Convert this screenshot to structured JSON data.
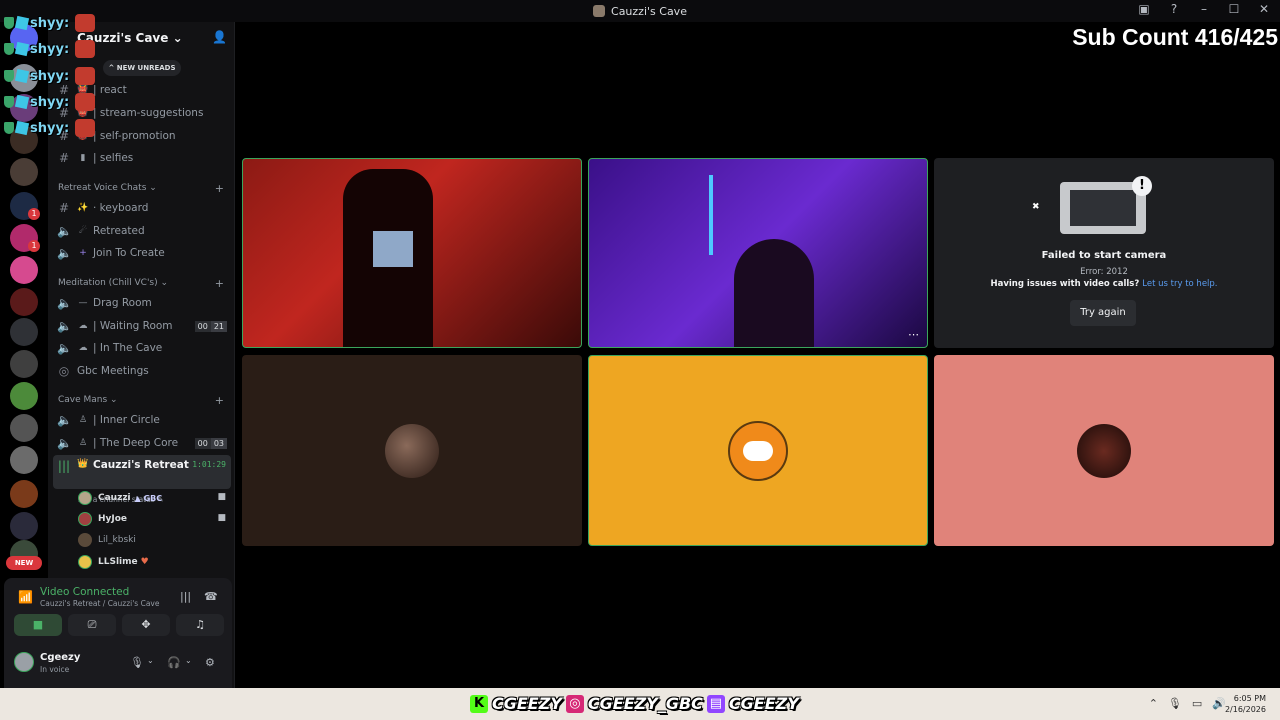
{
  "window": {
    "title": "Cauzzi's Cave",
    "controls": [
      "inbox-icon",
      "help-icon",
      "minimize",
      "maximize",
      "close"
    ]
  },
  "overlay": {
    "username": "shyy:",
    "rows": 5
  },
  "server": {
    "name": "Cauzzi's Cave ⌄",
    "new_unreads": "^ NEW UNREADS",
    "rail_new_badge": "NEW",
    "rail_badges": [
      "1",
      "1",
      "1"
    ]
  },
  "channels": {
    "top": [
      {
        "emoji": "",
        "label": "| react"
      },
      {
        "emoji": "",
        "label": "| stream-suggestions"
      },
      {
        "emoji": "",
        "label": "| self-promotion"
      },
      {
        "emoji": "",
        "label": "| selfies"
      }
    ],
    "cat_retreat": "Retreat Voice Chats ⌄",
    "retreat": [
      {
        "type": "text",
        "emoji": "✨",
        "label": "· keyboard"
      },
      {
        "type": "voice",
        "emoji": "",
        "label": "Retreated"
      },
      {
        "type": "voice",
        "emoji": "",
        "label": "Join To Create"
      }
    ],
    "cat_meditation": "Meditation (Chill VC's) ⌄",
    "meditation": [
      {
        "label": "Drag Room",
        "emoji": "—"
      },
      {
        "label": "| Waiting Room",
        "emoji": "",
        "counts": [
          "00",
          "21"
        ]
      },
      {
        "label": "| In The Cave",
        "emoji": ""
      },
      {
        "label": "Gbc Meetings",
        "emoji": ""
      }
    ],
    "cat_cave": "Cave Mans ⌄",
    "cave": [
      {
        "label": "| Inner Circle",
        "emoji": ""
      },
      {
        "label": "| The Deep Core",
        "emoji": "",
        "counts": [
          "00",
          "03"
        ]
      }
    ],
    "active": {
      "label": "Cauzzi's Retreat",
      "timer": "1:01:29",
      "status": "Set a channel status"
    },
    "members": [
      {
        "name": "Cauzzi",
        "tag": "GBC",
        "camera": true
      },
      {
        "name": "HyJoe",
        "tag": "",
        "camera": true
      },
      {
        "name": "Lil_kbski",
        "tag": "",
        "camera": false,
        "dim": true
      },
      {
        "name": "LLSlime",
        "tag": "",
        "camera": false
      }
    ]
  },
  "voice_panel": {
    "title": "Video Connected",
    "subtitle": "Cauzzi's Retreat / Cauzzi's Cave",
    "user": "Cgeezy",
    "user_status": "In voice"
  },
  "stage": {
    "sub_count": "Sub Count 416/425",
    "failed_title": "Failed to start camera",
    "failed_error": "Error: 2012",
    "failed_help": "Having issues with video calls?",
    "failed_link": "Let us try to help.",
    "try_again": "Try again",
    "tile_colors": {
      "t1": "#c0261f",
      "t2": "#5a1fb0",
      "t3": "#1e1f22",
      "t4": "#2a1d16",
      "t5": "#eea622",
      "t6": "#e0837a"
    }
  },
  "taskbar": {
    "brand_k": "K",
    "brand_1": "CGEEZY",
    "brand_2": "CGEEZY_GBC",
    "brand_3": "CGEEZY",
    "time": "6:05 PM",
    "date": "2/16/2026"
  }
}
